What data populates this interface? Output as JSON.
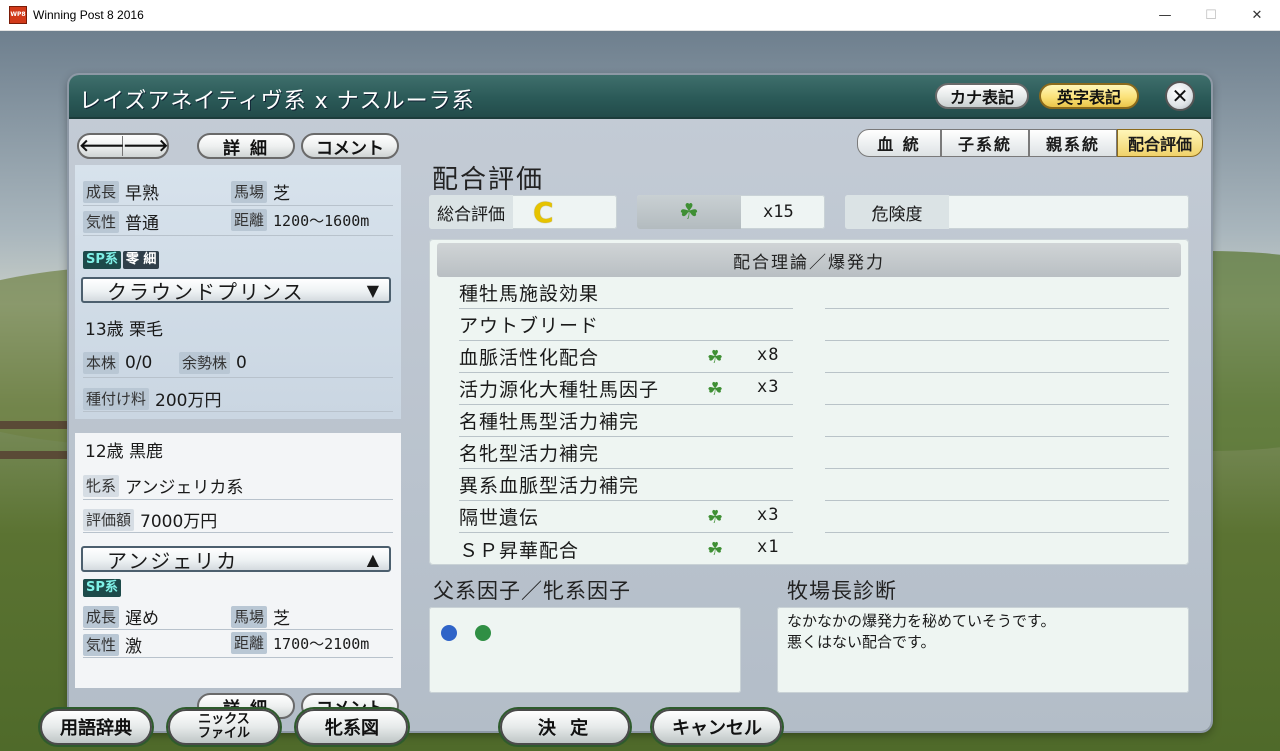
{
  "window": {
    "title": "Winning Post 8 2016",
    "icon_text": "WP8",
    "minimize": "—",
    "maximize": "☐",
    "close": "✕"
  },
  "header": {
    "title": "レイズアネイティヴ系 x ナスルーラ系",
    "kana_label": "カナ表記",
    "eiji_label": "英字表記",
    "close": "✕"
  },
  "left": {
    "prev": "🡐",
    "next": "🡒",
    "detail": "詳 細",
    "comment": "コメント",
    "sire": {
      "growth_label": "成長",
      "growth": "早熟",
      "track_label": "馬場",
      "track": "芝",
      "temper_label": "気性",
      "temper": "普通",
      "distance_label": "距離",
      "distance": "1200〜1600m",
      "tag_sp": "SP系",
      "tag_reisai": "零 細",
      "name": "クラウンドプリンス",
      "arrow": "▼",
      "age_color": "13歳 栗毛",
      "stock_label": "本株",
      "stock": "0/0",
      "yosei_label": "余勢株",
      "yosei": "0",
      "fee_label": "種付け料",
      "fee": "200万円"
    },
    "dam": {
      "age_color": "12歳 黒鹿",
      "line_label": "牝系",
      "line": "アンジェリカ系",
      "value_label": "評価額",
      "value": "7000万円",
      "name": "アンジェリカ",
      "arrow": "▲",
      "tag_sp": "SP系",
      "growth_label": "成長",
      "growth": "遅め",
      "track_label": "馬場",
      "track": "芝",
      "temper_label": "気性",
      "temper": "激",
      "distance_label": "距離",
      "distance": "1700〜2100m"
    },
    "detail2": "詳 細",
    "comment2": "コメント"
  },
  "tabs": [
    {
      "label": "血 統"
    },
    {
      "label": "子系統"
    },
    {
      "label": "親系統"
    },
    {
      "label": "配合評価"
    }
  ],
  "eval": {
    "title": "配合評価",
    "overall_label": "総合評価",
    "overall_grade": "C",
    "clover": "☘",
    "clover_mult": "x15",
    "risk_label": "危険度",
    "risk_value": ""
  },
  "theory": {
    "header": "配合理論／爆発力",
    "items": [
      {
        "label": "種牡馬施設効果",
        "clover": "",
        "mult": ""
      },
      {
        "label": "アウトブリード",
        "clover": "",
        "mult": ""
      },
      {
        "label": "血脈活性化配合",
        "clover": "☘",
        "mult": "x8"
      },
      {
        "label": "活力源化大種牡馬因子",
        "clover": "☘",
        "mult": "x3"
      },
      {
        "label": "名種牡馬型活力補完",
        "clover": "",
        "mult": ""
      },
      {
        "label": "名牝型活力補完",
        "clover": "",
        "mult": ""
      },
      {
        "label": "異系血脈型活力補完",
        "clover": "",
        "mult": ""
      },
      {
        "label": "隔世遺伝",
        "clover": "☘",
        "mult": "x3"
      },
      {
        "label": "ＳＰ昇華配合",
        "clover": "☘",
        "mult": "x1"
      }
    ]
  },
  "factors": {
    "title": "父系因子／牝系因子",
    "dot_colors": [
      "#2f64c8",
      "#2f8f44"
    ]
  },
  "diagnosis": {
    "title": "牧場長診断",
    "line1": "なかなかの爆発力を秘めていそうです。",
    "line2": "悪くはない配合です。"
  },
  "bottom": {
    "glossary": "用語辞典",
    "nicks_1": "ニックス",
    "nicks_2": "ファイル",
    "dam_chart": "牝系図",
    "ok": "決 定",
    "cancel": "キャンセル"
  }
}
